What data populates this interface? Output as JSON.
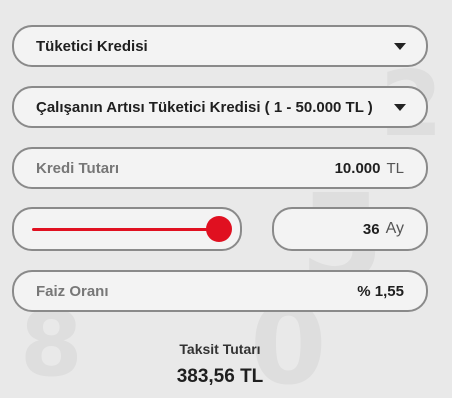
{
  "loan_type": {
    "selected": "Tüketici Kredisi"
  },
  "loan_product": {
    "selected": "Çalışanın Artısı Tüketici Kredisi ( 1 - 50.000 TL )"
  },
  "amount": {
    "placeholder": "Kredi Tutarı",
    "value": "10.000",
    "unit": "TL"
  },
  "term": {
    "value": "36",
    "unit": "Ay",
    "slider_fraction": 1.0
  },
  "interest": {
    "label": "Faiz Oranı",
    "value": "% 1,55"
  },
  "installment": {
    "label": "Taksit Tutarı",
    "value": "383,56 TL"
  },
  "colors": {
    "accent": "#e01020",
    "border": "#8a8a8a",
    "background": "#e9e9e9"
  },
  "icons": {
    "dropdown": "chevron-down-icon",
    "slider_thumb": "slider-thumb"
  }
}
